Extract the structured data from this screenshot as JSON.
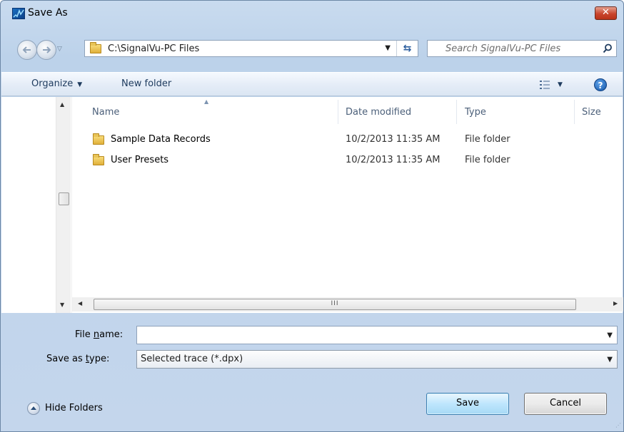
{
  "window": {
    "title": "Save As",
    "close_label": "✕"
  },
  "address": {
    "path": "C:\\SignalVu-PC Files",
    "dropdown_glyph": "▼",
    "refresh_glyph": "⇆"
  },
  "search": {
    "placeholder": "Search SignalVu-PC Files"
  },
  "toolbar": {
    "organize_label": "Organize",
    "new_folder_label": "New folder",
    "help_label": "?"
  },
  "columns": {
    "name": "Name",
    "date_modified": "Date modified",
    "type": "Type",
    "size": "Size"
  },
  "files": [
    {
      "name": "Sample Data Records",
      "date_modified": "10/2/2013 11:35 AM",
      "type": "File folder",
      "icon": "folder-icon"
    },
    {
      "name": "User Presets",
      "date_modified": "10/2/2013 11:35 AM",
      "type": "File folder",
      "icon": "folder-icon"
    }
  ],
  "hscroll_grip": "III",
  "form": {
    "file_name_label_pre": "File ",
    "file_name_label_u": "n",
    "file_name_label_post": "ame:",
    "file_name_value": "",
    "save_type_label_pre": "Save as ",
    "save_type_label_u": "t",
    "save_type_label_post": "ype:",
    "save_type_value": "Selected trace (*.dpx)"
  },
  "footer": {
    "hide_folders_label": "Hide Folders",
    "save_label": "Save",
    "cancel_label": "Cancel"
  },
  "colors": {
    "chrome": "#bcd2ea",
    "toolbar": "#e4ecf7",
    "save_button": "#bee6fd",
    "close_button": "#c9452d"
  }
}
